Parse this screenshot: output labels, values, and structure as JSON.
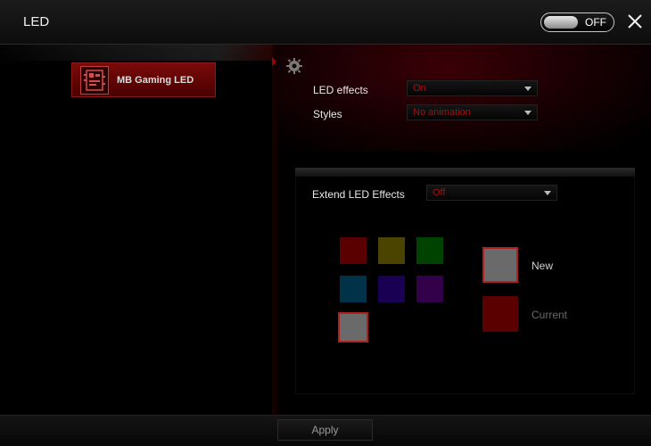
{
  "window": {
    "title": "LED"
  },
  "power_toggle": {
    "label": "OFF"
  },
  "sidebar": {
    "items": [
      {
        "label": "MB Gaming LED",
        "icon": "motherboard-icon"
      }
    ]
  },
  "settings": {
    "led_effects": {
      "label": "LED effects",
      "value": "On"
    },
    "styles": {
      "label": "Styles",
      "value": "No animation"
    }
  },
  "extend": {
    "label": "Extend LED Effects",
    "value": "Off",
    "palette": [
      {
        "name": "red",
        "color": "#5a0000"
      },
      {
        "name": "yellow",
        "color": "#4a4400"
      },
      {
        "name": "green",
        "color": "#004200"
      },
      {
        "name": "blue",
        "color": "#00324a"
      },
      {
        "name": "indigo",
        "color": "#1a0052"
      },
      {
        "name": "purple",
        "color": "#33004a"
      },
      {
        "name": "white",
        "color": "#6a6a6a"
      }
    ],
    "new_label": "New",
    "current_label": "Current",
    "new_color": "#6a6a6a",
    "current_color": "#5a0000"
  },
  "footer": {
    "apply_label": "Apply"
  },
  "colors": {
    "accent": "#a01010"
  }
}
